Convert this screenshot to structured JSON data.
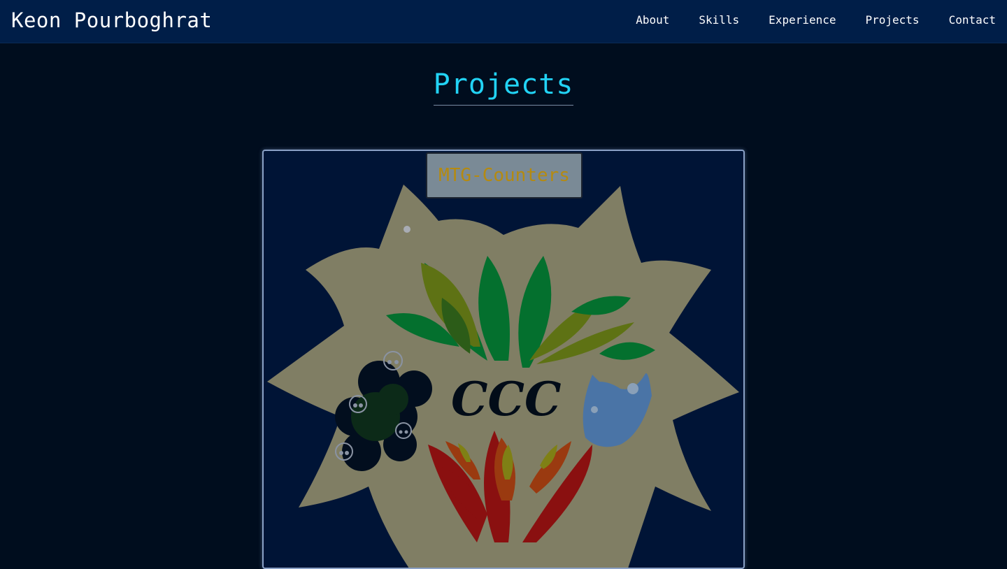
{
  "header": {
    "brand": "Keon Pourboghrat",
    "nav": [
      "About",
      "Skills",
      "Experience",
      "Projects",
      "Contact"
    ]
  },
  "section": {
    "title": "Projects"
  },
  "projects": [
    {
      "label": "MTG-Counters",
      "logo_text": "CCC"
    }
  ],
  "colors": {
    "navbar": "#001e48",
    "background": "#000d1e",
    "accent": "#22d3f5",
    "card_bg": "#001436",
    "label_text": "#b58a10"
  }
}
